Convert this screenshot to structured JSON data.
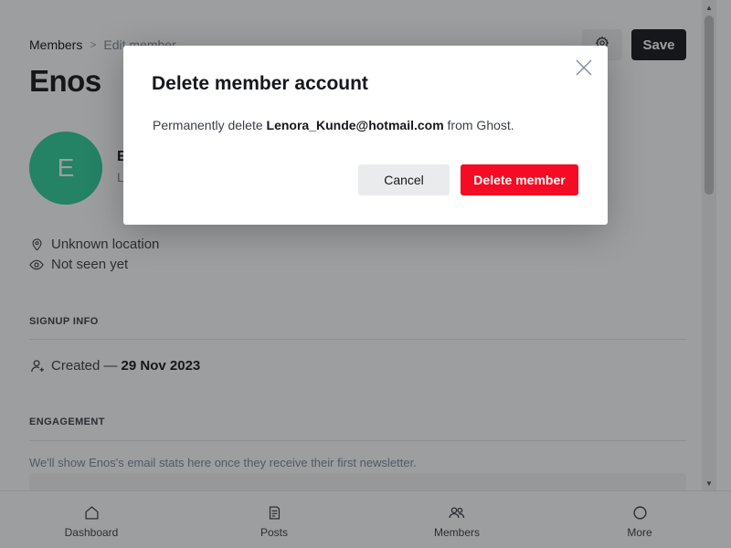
{
  "breadcrumb": {
    "parent": "Members",
    "separator": ">",
    "current": "Edit member"
  },
  "header": {
    "settings_icon": "gear-icon",
    "save_label": "Save"
  },
  "page_title": "Enos",
  "member": {
    "avatar_initial": "E",
    "avatar_color": "#30cf9b",
    "name_visible": "E",
    "email_visible": "L"
  },
  "meta": {
    "location": "Unknown location",
    "seen": "Not seen yet"
  },
  "signup_info": {
    "heading": "SIGNUP INFO",
    "created_label": "Created —",
    "created_date": "29 Nov 2023"
  },
  "engagement": {
    "heading": "ENGAGEMENT",
    "text": "We'll show Enos's email stats here once they receive their first newsletter."
  },
  "bottom_nav": {
    "items": [
      {
        "label": "Dashboard",
        "icon": "home-icon"
      },
      {
        "label": "Posts",
        "icon": "posts-icon"
      },
      {
        "label": "Members",
        "icon": "members-icon"
      },
      {
        "label": "More",
        "icon": "more-icon"
      }
    ]
  },
  "modal": {
    "title": "Delete member account",
    "body_prefix": "Permanently delete",
    "email": "Lenora_Kunde@hotmail.com",
    "body_suffix": "from Ghost.",
    "cancel_label": "Cancel",
    "delete_label": "Delete member",
    "delete_color": "#f50b23",
    "close_icon": "close-icon"
  }
}
